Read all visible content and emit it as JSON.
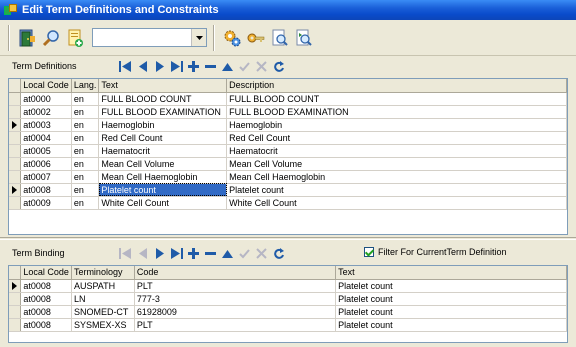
{
  "window": {
    "title": "Edit Term Definitions and Constraints"
  },
  "toolbar": {
    "buttons": [
      {
        "name": "exit-door-icon"
      },
      {
        "name": "search-icon"
      },
      {
        "name": "new-document-icon"
      }
    ],
    "combo_value": "",
    "buttons_right": [
      {
        "name": "settings-gears-icon"
      },
      {
        "name": "key-icon"
      },
      {
        "name": "find-document-icon"
      },
      {
        "name": "find-next-document-icon"
      }
    ]
  },
  "definitions": {
    "label": "Term Definitions",
    "columns": [
      "Local Code",
      "Lang.",
      "Text",
      "Description"
    ],
    "rows": [
      {
        "code": "at0000",
        "lang": "en",
        "text": "FULL BLOOD COUNT",
        "desc": "FULL BLOOD COUNT",
        "marker": false,
        "selected": false
      },
      {
        "code": "at0002",
        "lang": "en",
        "text": "FULL BLOOD EXAMINATION",
        "desc": "FULL BLOOD EXAMINATION",
        "marker": false,
        "selected": false
      },
      {
        "code": "at0003",
        "lang": "en",
        "text": "Haemoglobin",
        "desc": "Haemoglobin",
        "marker": true,
        "selected": false
      },
      {
        "code": "at0004",
        "lang": "en",
        "text": "Red Cell Count",
        "desc": "Red Cell Count",
        "marker": false,
        "selected": false
      },
      {
        "code": "at0005",
        "lang": "en",
        "text": "Haematocrit",
        "desc": "Haematocrit",
        "marker": false,
        "selected": false
      },
      {
        "code": "at0006",
        "lang": "en",
        "text": "Mean Cell Volume",
        "desc": "Mean Cell Volume",
        "marker": false,
        "selected": false
      },
      {
        "code": "at0007",
        "lang": "en",
        "text": "Mean Cell Haemoglobin",
        "desc": "Mean Cell Haemoglobin",
        "marker": false,
        "selected": false
      },
      {
        "code": "at0008",
        "lang": "en",
        "text": "Platelet count",
        "desc": "Platelet count",
        "marker": true,
        "selected": true
      },
      {
        "code": "at0009",
        "lang": "en",
        "text": "White Cell Count",
        "desc": "White Cell Count",
        "marker": false,
        "selected": false
      }
    ]
  },
  "binding": {
    "label": "Term Binding",
    "filter_label": "Filter For CurrentTerm Definition",
    "filter_checked": true,
    "columns": [
      "Local Code",
      "Terminology",
      "Code",
      "Text"
    ],
    "rows": [
      {
        "code": "at0008",
        "terminology": "AUSPATH",
        "tcode": "PLT",
        "text": "Platelet count",
        "marker": true
      },
      {
        "code": "at0008",
        "terminology": "LN",
        "tcode": "777-3",
        "text": "Platelet count",
        "marker": false
      },
      {
        "code": "at0008",
        "terminology": "SNOMED-CT",
        "tcode": "61928009",
        "text": "Platelet count",
        "marker": false
      },
      {
        "code": "at0008",
        "terminology": "SYSMEX-XS",
        "tcode": "PLT",
        "text": "Platelet count",
        "marker": false
      }
    ]
  },
  "colors": {
    "nav": "#1f5ba8",
    "nav_disabled": "#b6b6c4",
    "accent": "#316ac5",
    "title": "#0a4ccc"
  }
}
